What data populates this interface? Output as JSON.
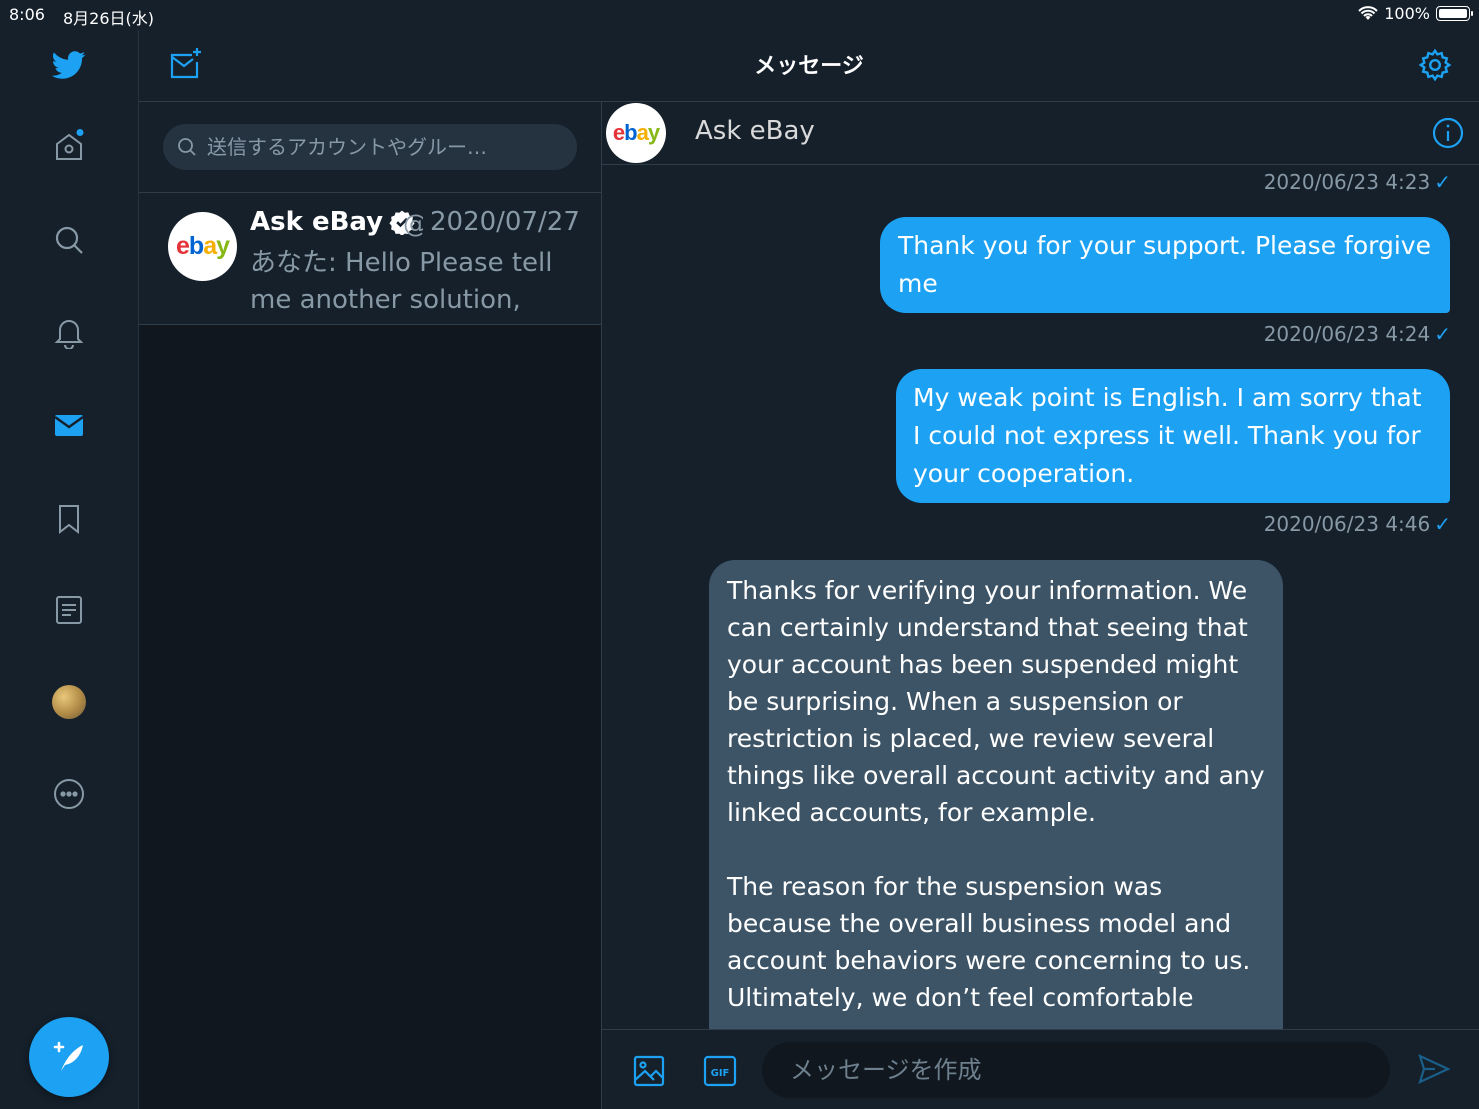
{
  "status_bar": {
    "time": "8:06",
    "date": "8月26日(水)",
    "battery": "100%",
    "battery_level": 1.0
  },
  "colors": {
    "background": "#15202b",
    "accent": "#1da1f2",
    "incoming_bubble": "#3d5466",
    "secondary_text": "#8899a6"
  },
  "nav": {
    "items": [
      {
        "icon": "twitter-bird-icon"
      },
      {
        "icon": "home-icon"
      },
      {
        "icon": "search-icon"
      },
      {
        "icon": "notifications-bell-icon"
      },
      {
        "icon": "messages-envelope-icon",
        "active": true
      },
      {
        "icon": "bookmark-icon"
      },
      {
        "icon": "lists-icon"
      },
      {
        "icon": "profile-avatar"
      },
      {
        "icon": "more-icon"
      }
    ],
    "compose_icon": "compose-tweet-icon"
  },
  "header": {
    "title": "メッセージ"
  },
  "search": {
    "placeholder": "送信するアカウントやグルー…"
  },
  "conversations": [
    {
      "name": "Ask eBay",
      "handle": "@",
      "date": "2020/07/27",
      "preview": "あなた: Hello Please tell me another solution,"
    }
  ],
  "chat": {
    "contact_name": "Ask eBay",
    "logo_text": "ebay",
    "messages": [
      {
        "type": "timestamp",
        "text": "2020/06/23 4:23",
        "check": "✓"
      },
      {
        "type": "outgoing",
        "text": "Thank you for your support.  Please forgive me"
      },
      {
        "type": "timestamp",
        "text": "2020/06/23 4:24",
        "check": "✓"
      },
      {
        "type": "outgoing",
        "text": "My weak point is English.  I am sorry that I could not express it well.  Thank you for your cooperation."
      },
      {
        "type": "timestamp",
        "text": "2020/06/23 4:46",
        "check": "✓"
      },
      {
        "type": "incoming",
        "paragraph_1": "Thanks for verifying your information. We can certainly understand that seeing that your account has been suspended might be surprising. When a suspension or restriction is placed, we review several things like overall account activity and any linked accounts, for example.",
        "paragraph_2": "The reason for the suspension was because the overall business model and account behaviors were concerning to us. Ultimately, we don’t feel comfortable"
      }
    ]
  },
  "composer": {
    "placeholder": "メッセージを作成",
    "gif_label": "GIF"
  }
}
